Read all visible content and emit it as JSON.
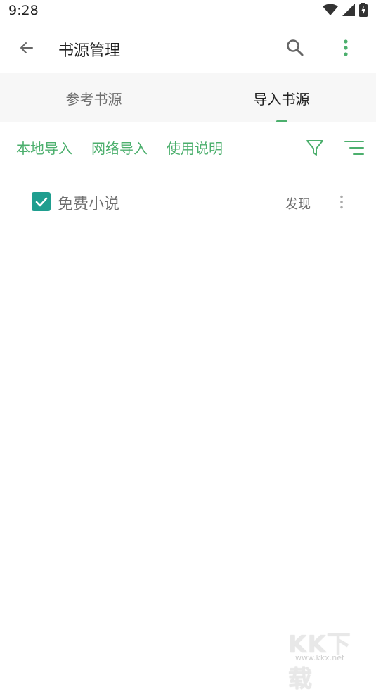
{
  "status_bar": {
    "time": "9:28"
  },
  "app_bar": {
    "title": "书源管理"
  },
  "tabs": [
    {
      "label": "参考书源",
      "selected": false
    },
    {
      "label": "导入书源",
      "selected": true
    }
  ],
  "toolbar": {
    "links": [
      "本地导入",
      "网络导入",
      "使用说明"
    ]
  },
  "list": [
    {
      "name": "免费小说",
      "checked": true,
      "action": "发现"
    }
  ],
  "watermark": {
    "logo": "KK下载",
    "url": "www.kkx.net"
  },
  "colors": {
    "accent": "#4caf6d",
    "checkbox": "#1f9e8f",
    "tab_bg": "#f7f7f7"
  }
}
